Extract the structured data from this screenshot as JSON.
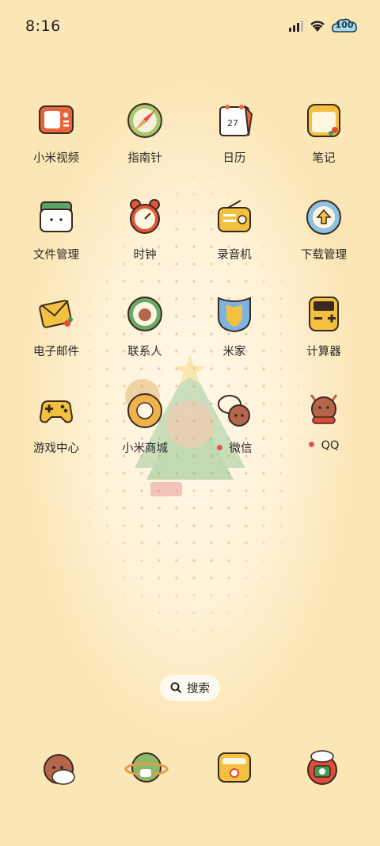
{
  "status_bar": {
    "time": "8:16",
    "battery": "100"
  },
  "apps": [
    {
      "label": "小米视频",
      "icon": "video-icon"
    },
    {
      "label": "指南针",
      "icon": "compass-icon"
    },
    {
      "label": "日历",
      "icon": "calendar-icon",
      "date": "27"
    },
    {
      "label": "笔记",
      "icon": "notes-icon"
    },
    {
      "label": "文件管理",
      "icon": "folder-icon"
    },
    {
      "label": "时钟",
      "icon": "clock-icon"
    },
    {
      "label": "录音机",
      "icon": "recorder-icon"
    },
    {
      "label": "下载管理",
      "icon": "download-icon"
    },
    {
      "label": "电子邮件",
      "icon": "email-icon"
    },
    {
      "label": "联系人",
      "icon": "contacts-icon"
    },
    {
      "label": "米家",
      "icon": "mijia-icon"
    },
    {
      "label": "计算器",
      "icon": "calculator-icon"
    },
    {
      "label": "游戏中心",
      "icon": "gamepad-icon"
    },
    {
      "label": "小米商城",
      "icon": "mall-icon"
    },
    {
      "label": "微信",
      "icon": "wechat-icon",
      "notification": true
    },
    {
      "label": "QQ",
      "icon": "qq-icon",
      "notification": true
    }
  ],
  "search": {
    "label": "搜索"
  },
  "dock": [
    {
      "icon": "phone-icon"
    },
    {
      "icon": "browser-icon"
    },
    {
      "icon": "messages-icon"
    },
    {
      "icon": "camera-icon"
    }
  ]
}
